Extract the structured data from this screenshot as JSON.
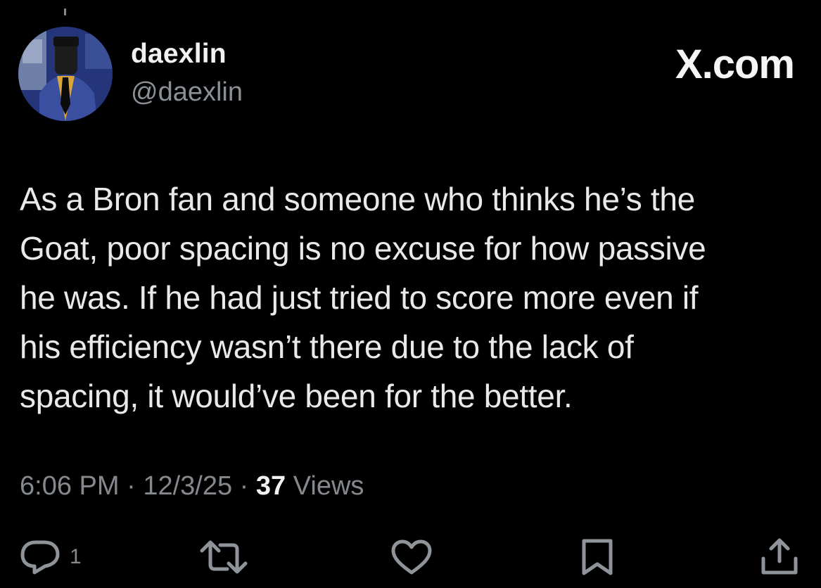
{
  "user": {
    "display_name": "daexlin",
    "handle": "@daexlin"
  },
  "brand": {
    "label": "X.com"
  },
  "tweet": {
    "lines": [
      "As a Bron fan and someone who thinks he’s the",
      "Goat, poor spacing is no excuse for how passive",
      "he was. If he had just tried to score more even if",
      "his efficiency wasn’t there due to the lack of",
      "spacing, it would’ve been for the better."
    ]
  },
  "meta": {
    "time": "6:06 PM",
    "separator": "·",
    "date": "12/3/25",
    "views_count": "37",
    "views_label": "Views"
  },
  "actions": {
    "reply_count": "1",
    "icons": [
      "reply-icon",
      "repost-icon",
      "like-icon",
      "bookmark-icon",
      "share-icon"
    ]
  },
  "colors": {
    "background": "#000000",
    "primary_text": "#e7e9ea",
    "secondary_text": "#85898e",
    "icon": "#8f949a"
  }
}
